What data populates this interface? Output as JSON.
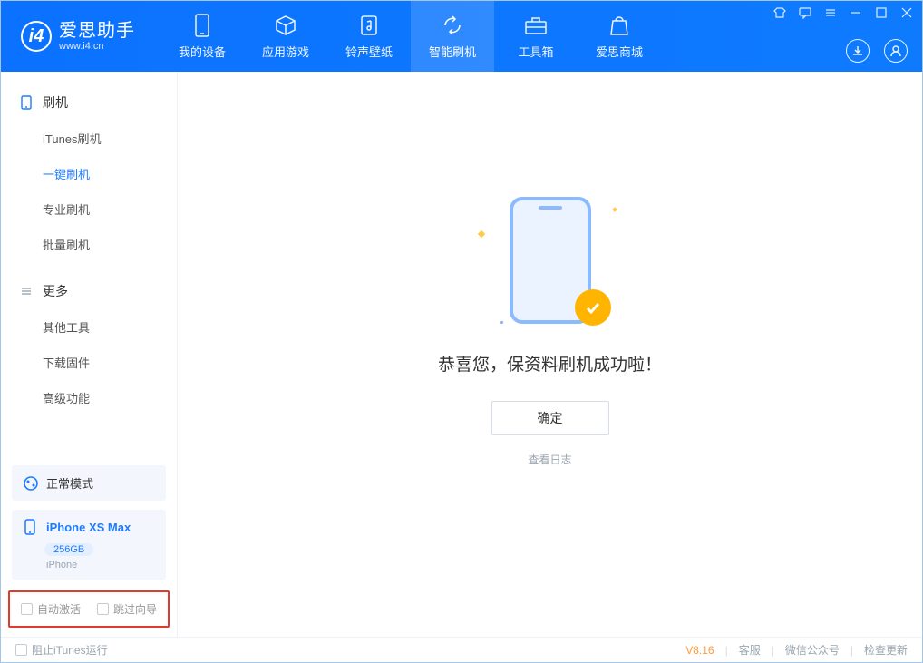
{
  "logo": {
    "main": "爱思助手",
    "sub": "www.i4.cn"
  },
  "tabs": {
    "device": "我的设备",
    "apps": "应用游戏",
    "ring": "铃声壁纸",
    "flash": "智能刷机",
    "tools": "工具箱",
    "store": "爱思商城"
  },
  "sidebar": {
    "section_flash": "刷机",
    "itunes": "iTunes刷机",
    "onekey": "一键刷机",
    "pro": "专业刷机",
    "batch": "批量刷机",
    "section_more": "更多",
    "other": "其他工具",
    "download": "下载固件",
    "advanced": "高级功能"
  },
  "mode": {
    "label": "正常模式"
  },
  "device": {
    "name": "iPhone XS Max",
    "storage": "256GB",
    "type": "iPhone"
  },
  "options": {
    "auto_activate": "自动激活",
    "skip_guide": "跳过向导"
  },
  "main": {
    "message": "恭喜您，保资料刷机成功啦！",
    "ok": "确定",
    "log": "查看日志"
  },
  "footer": {
    "block_itunes": "阻止iTunes运行",
    "version": "V8.16",
    "service": "客服",
    "wechat": "微信公众号",
    "update": "检查更新"
  }
}
